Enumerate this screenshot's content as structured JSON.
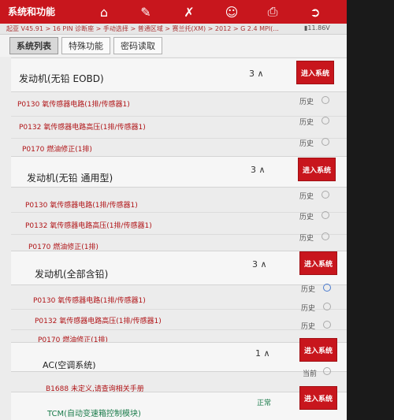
{
  "header": {
    "title": "系统和功能",
    "icons": [
      "home-icon",
      "edit-icon",
      "tools-icon",
      "user-icon",
      "print-icon",
      "exit-icon"
    ]
  },
  "breadcrumb": "起亚 V45.91 > 16 PIN 诊断座 > 手动选择 > 普通区域 > 赛兰托(XM) > 2012 > G 2.4 MPI(...",
  "battery": "11.86V",
  "tabs": [
    "系统列表",
    "特殊功能",
    "密码读取"
  ],
  "enter_label": "进入系统",
  "history_label": "历史",
  "current_label": "当前",
  "normal_label": "正常",
  "systems": [
    {
      "name": "发动机(无铅 EOBD)",
      "count": "3",
      "dtcs": [
        {
          "text": "P0130 氧传感器电路(1排/传感器1)",
          "status": "历史"
        },
        {
          "text": "P0132 氧传感器电路高压(1排/传感器1)",
          "status": "历史"
        },
        {
          "text": "P0170 燃油修正(1排)",
          "status": "历史"
        }
      ]
    },
    {
      "name": "发动机(无铅 通用型)",
      "count": "3",
      "dtcs": [
        {
          "text": "P0130 氧传感器电路(1排/传感器1)",
          "status": "历史"
        },
        {
          "text": "P0132 氧传感器电路高压(1排/传感器1)",
          "status": "历史"
        },
        {
          "text": "P0170 燃油修正(1排)",
          "status": "历史"
        }
      ]
    },
    {
      "name": "发动机(全部含铅)",
      "count": "3",
      "dtcs": [
        {
          "text": "P0130 氧传感器电路(1排/传感器1)",
          "status": "历史"
        },
        {
          "text": "P0132 氧传感器电路高压(1排/传感器1)",
          "status": "历史"
        },
        {
          "text": "P0170 燃油修正(1排)",
          "status": "历史"
        }
      ]
    },
    {
      "name": "AC(空调系统)",
      "count": "1",
      "dtcs": [
        {
          "text": "B1688 未定义,请查询相关手册",
          "status": "当前"
        }
      ]
    },
    {
      "name": "TCM(自动变速箱控制模块)",
      "status": "正常"
    }
  ],
  "colors": {
    "accent": "#c8161d",
    "dtc_text": "#b01417",
    "ok_text": "#1a7b4a"
  }
}
